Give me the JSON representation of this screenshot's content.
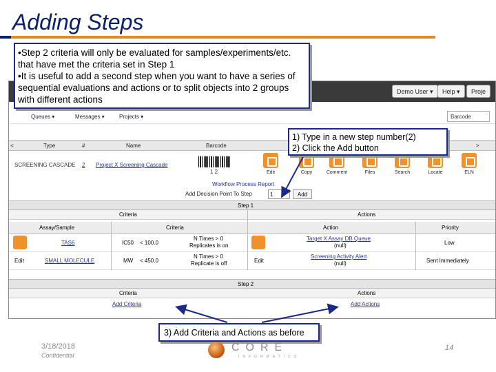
{
  "slide": {
    "title": "Adding Steps",
    "bullets": [
      "•Step 2 criteria will only be evaluated for samples/experiments/etc. that have met the criteria set in Step 1",
      "•It is useful to add a second step when you want to have a series of sequential evaluations and actions or to split objects into 2 groups with different actions"
    ],
    "callout_steps": [
      "1) Type in a new step number(2)",
      "2) Click the Add button"
    ],
    "callout_criteria": "3) Add Criteria and Actions as before",
    "footer_date": "3/18/2018",
    "footer_confidential": "Confidential",
    "page_number": "14",
    "logo_text": "CORE",
    "logo_sub": "INFORMATICS"
  },
  "app": {
    "topbar": {
      "user_menu": "Demo User ▾",
      "help_menu": "Help ▾",
      "proj_menu": "Proje"
    },
    "nav": {
      "queues": "Queues ▾",
      "messages": "Messages ▾",
      "projects": "Projects ▾",
      "search_placeholder": "Barcode"
    },
    "grid_headers": {
      "type": "Type",
      "num": "#",
      "name": "Name",
      "barcode": "Barcode",
      "prev": "<",
      "next": ">"
    },
    "row": {
      "type": "SCREENING CASCADE",
      "num": "2",
      "name": "Project X Screening Cascade",
      "barcode_num": "1 2"
    },
    "actions": [
      "Edit",
      "Copy",
      "Comment",
      "Files",
      "Search",
      "Locate",
      "ELN"
    ],
    "workflow_report": "Workflow Process Report",
    "add_decision_label": "Add Decision Point To Step",
    "step_value": "1",
    "add_button": "Add",
    "step1": {
      "title": "Step 1",
      "criteria_label": "Criteria",
      "actions_label": "Actions",
      "columns": {
        "assay": "Assay/Sample",
        "criteria": "Criteria",
        "action": "Action",
        "priority": "Priority"
      },
      "rows": [
        {
          "edit": "Edit",
          "assay": "TAS6",
          "crit1": "IC50",
          "crit2": "< 100.0",
          "crit3a": "N Times > 0",
          "crit3b": "Replicates is on",
          "action1": "Target X Assay DB Queue",
          "action2": "(null)",
          "priority": "Low"
        },
        {
          "edit": "Edit",
          "assay": "SMALL MOLECULE",
          "crit1": "MW",
          "crit2": "< 450.0",
          "crit3a": "N Times > 0",
          "crit3b": "Replicate is off",
          "action1": "Screening Activity Alert",
          "action2": "(null)",
          "priority": "Sent Immediately"
        }
      ]
    },
    "step2": {
      "title": "Step 2",
      "criteria_label": "Criteria",
      "actions_label": "Actions",
      "add_criteria": "Add Criteria",
      "add_actions": "Add Actions"
    }
  }
}
